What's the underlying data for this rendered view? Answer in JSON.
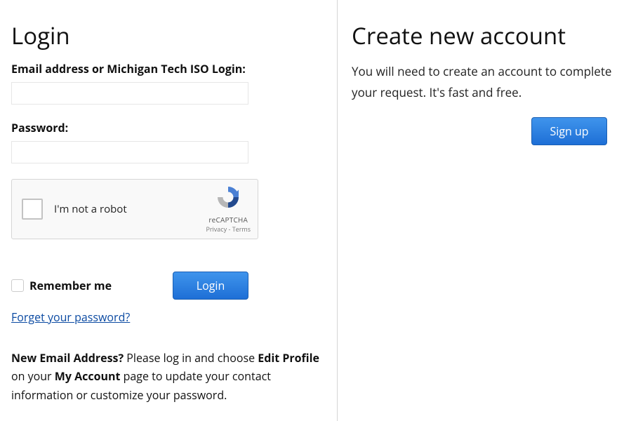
{
  "login": {
    "heading": "Login",
    "email_label": "Email address or Michigan Tech ISO Login:",
    "email_value": "",
    "password_label": "Password:",
    "password_value": "",
    "recaptcha": {
      "label": "I'm not a robot",
      "brand": "reCAPTCHA",
      "links": "Privacy - Terms"
    },
    "remember_label": "Remember me",
    "login_button": "Login",
    "forgot_link": "Forget your password?",
    "help": {
      "lead_bold": "New Email Address?",
      "part1": " Please log in and choose ",
      "edit_profile_bold": "Edit Profile",
      "part2": " on your ",
      "my_account_bold": "My Account",
      "part3": " page to update your contact information or customize your password."
    }
  },
  "signup": {
    "heading": "Create new account",
    "description": "You will need to create an account to complete your request. It's fast and free.",
    "button": "Sign up"
  }
}
